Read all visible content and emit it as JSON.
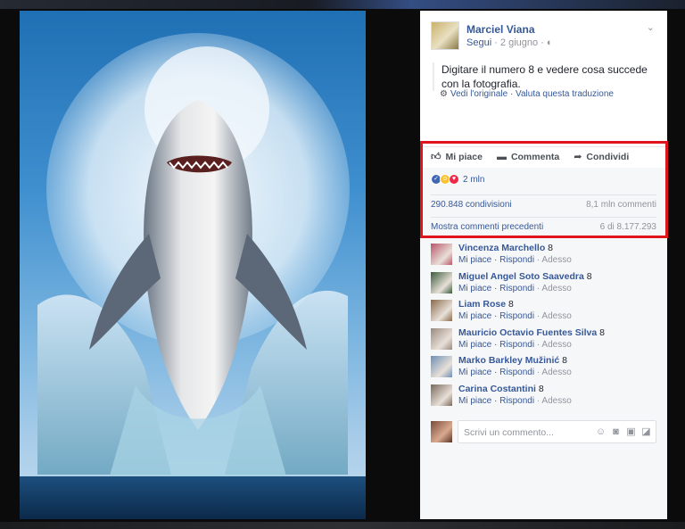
{
  "post": {
    "author": "Marciel Viana",
    "follow": "Segui",
    "date": "· 2 giugno ·",
    "text": "Digitare il numero 8 e vedere cosa succede con la fotografia.",
    "see_original": "Vedi l'originale",
    "rate_translation": "· Valuta questa traduzione"
  },
  "actions": {
    "like": "Mi piace",
    "comment": "Commenta",
    "share": "Condividi"
  },
  "stats": {
    "reactions": "2 mln",
    "shares": "290.848 condivisioni",
    "comments": "8,1 mln commenti",
    "previous": "Mostra commenti precedenti",
    "range": "6 di 8.177.293"
  },
  "comments": [
    {
      "name": "Vincenza Marchello",
      "text": " 8",
      "avatar": "#b9556a"
    },
    {
      "name": "Miguel Angel Soto Saavedra",
      "text": " 8",
      "avatar": "#3a5a3a"
    },
    {
      "name": "Liam Rose",
      "text": " 8",
      "avatar": "#8a6a4a"
    },
    {
      "name": "Mauricio Octavio Fuentes Silva",
      "text": " 8",
      "avatar": "#9a8a80"
    },
    {
      "name": "Marko Barkley Mužinić",
      "text": " 8",
      "avatar": "#6d8fb5"
    },
    {
      "name": "Carina Costantini",
      "text": " 8",
      "avatar": "#7a6a5a"
    }
  ],
  "comment_links": {
    "like": "Mi piace",
    "reply": "· Rispondi",
    "time": "· Adesso"
  },
  "composer": {
    "placeholder": "Scrivi un commento..."
  },
  "icons": {
    "gear": "gear-icon",
    "like": "thumbs-up-icon",
    "comment": "speech-bubble-icon",
    "share": "share-arrow-icon"
  }
}
